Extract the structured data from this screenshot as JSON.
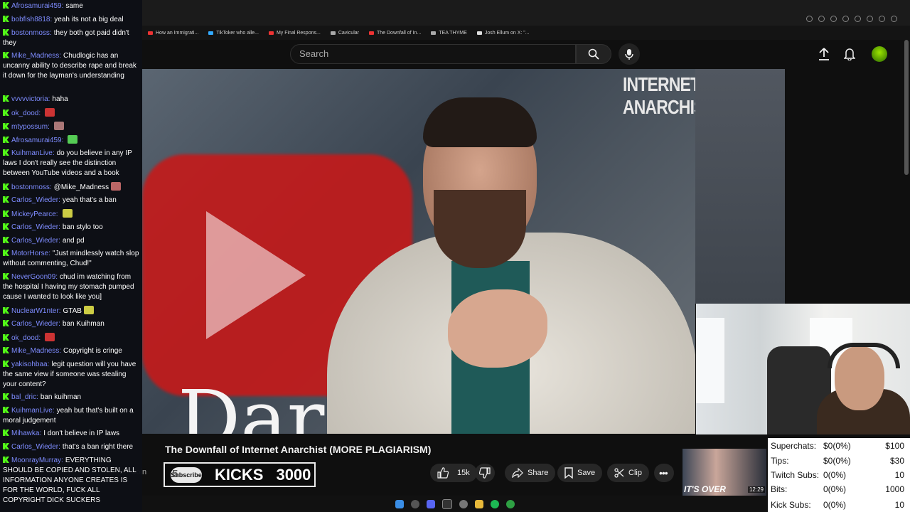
{
  "bookmarks": [
    {
      "label": "How an Immigrati...",
      "color": "#e33"
    },
    {
      "label": "TikToker who alle...",
      "color": "#3af"
    },
    {
      "label": "My Final Respons...",
      "color": "#e33"
    },
    {
      "label": "Cavicular",
      "color": "#aaa"
    },
    {
      "label": "The Downfall of In...",
      "color": "#e33"
    },
    {
      "label": "TEA THYME",
      "color": "#aaa"
    },
    {
      "label": "Josh Ellum on X: \"...",
      "color": "#ddd"
    }
  ],
  "header": {
    "search_placeholder": "Search"
  },
  "video": {
    "watermark": "INTERNET ANARCHIST",
    "overlay_text": "Dar",
    "title": "The Downfall of Internet Anarchist (MORE PLAGIARISM)"
  },
  "actions": {
    "join": "Join",
    "subscribe": "Subscribe",
    "likes": "15k",
    "share": "Share",
    "save": "Save",
    "clip": "Clip"
  },
  "kicks": {
    "badge": "5",
    "label": "KICKS",
    "value": "3000"
  },
  "news": {
    "caption": "IT'S OVER",
    "time": "12:29"
  },
  "stats": [
    {
      "label": "Superchats:",
      "value": "$0(0%)",
      "max": "$100"
    },
    {
      "label": "Tips:",
      "value": "$0(0%)",
      "max": "$30"
    },
    {
      "label": "Twitch Subs:",
      "value": "0(0%)",
      "max": "10"
    },
    {
      "label": "Bits:",
      "value": "0(0%)",
      "max": "1000"
    },
    {
      "label": "Kick Subs:",
      "value": "0(0%)",
      "max": "10"
    }
  ],
  "chat": [
    {
      "user": "Afrosamurai459:",
      "text": "same"
    },
    {
      "user": "bobfish8818:",
      "text": "yeah its not a big deal"
    },
    {
      "user": "bostonmoss:",
      "text": "they both got paid didn't they"
    },
    {
      "user": "Mike_Madness:",
      "text": "Chudlogic has an uncanny ability to describe rape and break it down for the layman's understanding"
    },
    {
      "user": "vvvvvictoria:",
      "text": "haha"
    },
    {
      "user": "ok_dood:",
      "text": "",
      "emote": "#c33"
    },
    {
      "user": "mtypossum:",
      "text": "",
      "emote": "#a77"
    },
    {
      "user": "Afrosamurai459:",
      "text": "",
      "emote": "#5c5"
    },
    {
      "user": "KuihmanLive:",
      "text": "do you believe in any IP laws I don't really see the distinction between YouTube videos and a book"
    },
    {
      "user": "bostonmoss:",
      "text": "@Mike_Madness",
      "emote": "#b66"
    },
    {
      "user": "Carlos_Wieder:",
      "text": "yeah that's a ban"
    },
    {
      "user": "MickeyPearce:",
      "text": "",
      "emote": "#cc4"
    },
    {
      "user": "Carlos_Wieder:",
      "text": "ban stylo too"
    },
    {
      "user": "Carlos_Wieder:",
      "text": "and pd"
    },
    {
      "user": "MotorHorse:",
      "text": "\"Just mindlessly watch slop without commenting, Chud!\""
    },
    {
      "user": "NeverGoon09:",
      "text": "chud im watching from the hospital I having my stomach pumped cause I wanted to look like you]"
    },
    {
      "user": "NuclearW1nter:",
      "text": "GTAB",
      "emote": "#cc4"
    },
    {
      "user": "Carlos_Wieder:",
      "text": "ban Kuihman"
    },
    {
      "user": "ok_dood:",
      "text": "",
      "emote": "#c33"
    },
    {
      "user": "Mike_Madness:",
      "text": "Copyright is cringe"
    },
    {
      "user": "yakisohbaa:",
      "text": "legit question will you have the same view if someone was stealing your content?"
    },
    {
      "user": "bal_dric:",
      "text": "ban kuihman"
    },
    {
      "user": "KuihmanLive:",
      "text": "yeah but that's built on a moral judgement"
    },
    {
      "user": "Mihawka:",
      "text": "I don't believe in IP laws"
    },
    {
      "user": "Carlos_Wieder:",
      "text": "that's a ban right there"
    },
    {
      "user": "MoonrayMurray:",
      "text": "EVERYTHING SHOULD BE COPIED AND STOLEN, ALL INFORMATION ANYONE CREATES IS FOR THE WORLD, FUCK ALL COPYRIGHT DICK SUCKERS"
    }
  ],
  "colors": {
    "kick_green": "#53fc18",
    "chat_username": "#7e8cff",
    "yt_red": "#c51a1a"
  }
}
